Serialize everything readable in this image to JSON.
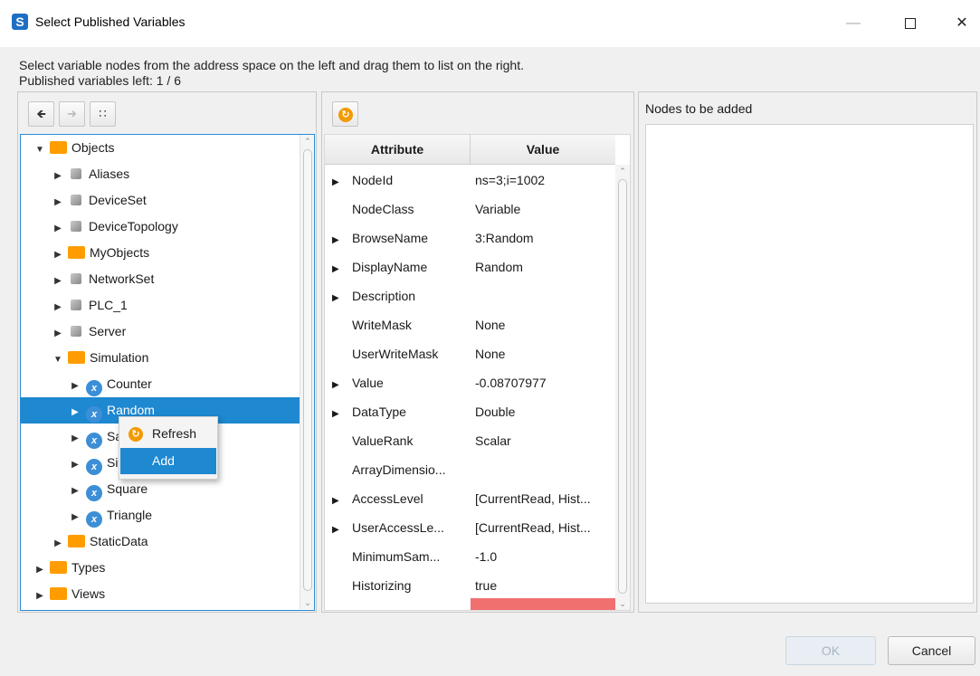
{
  "window": {
    "title": "Select Published Variables",
    "app_icon_letter": "S"
  },
  "instructions": {
    "line1": "Select variable nodes from the address space on the left and drag them to list on the right.",
    "line2": "Published variables left: 1 / 6"
  },
  "left_toolbar": {
    "back_icon": "arrow-left-icon",
    "forward_icon": "arrow-right-icon",
    "collapse_icon": "collapse-icon"
  },
  "tree": [
    {
      "label": "Objects",
      "icon": "folder",
      "level": 0,
      "expanded": true
    },
    {
      "label": "Aliases",
      "icon": "cube",
      "level": 1,
      "expanded": false
    },
    {
      "label": "DeviceSet",
      "icon": "cube",
      "level": 1,
      "expanded": false
    },
    {
      "label": "DeviceTopology",
      "icon": "cube",
      "level": 1,
      "expanded": false
    },
    {
      "label": "MyObjects",
      "icon": "folder",
      "level": 1,
      "expanded": false
    },
    {
      "label": "NetworkSet",
      "icon": "cube",
      "level": 1,
      "expanded": false
    },
    {
      "label": "PLC_1",
      "icon": "cube",
      "level": 1,
      "expanded": false
    },
    {
      "label": "Server",
      "icon": "cube",
      "level": 1,
      "expanded": false
    },
    {
      "label": "Simulation",
      "icon": "folder",
      "level": 1,
      "expanded": true
    },
    {
      "label": "Counter",
      "icon": "variable",
      "level": 2,
      "expanded": false
    },
    {
      "label": "Random",
      "icon": "variable",
      "level": 2,
      "expanded": false,
      "selected": true
    },
    {
      "label": "Sawtooth",
      "icon": "variable",
      "level": 2,
      "expanded": false
    },
    {
      "label": "Sinusoid",
      "icon": "variable",
      "level": 2,
      "expanded": false
    },
    {
      "label": "Square",
      "icon": "variable",
      "level": 2,
      "expanded": false
    },
    {
      "label": "Triangle",
      "icon": "variable",
      "level": 2,
      "expanded": false
    },
    {
      "label": "StaticData",
      "icon": "folder",
      "level": 1,
      "expanded": false
    },
    {
      "label": "Types",
      "icon": "folder",
      "level": 0,
      "expanded": false
    },
    {
      "label": "Views",
      "icon": "folder",
      "level": 0,
      "expanded": false
    }
  ],
  "attributes": {
    "header_attribute": "Attribute",
    "header_value": "Value",
    "rows": [
      {
        "name": "NodeId",
        "value": "ns=3;i=1002",
        "expandable": true
      },
      {
        "name": "NodeClass",
        "value": "Variable",
        "expandable": false
      },
      {
        "name": "BrowseName",
        "value": "3:Random",
        "expandable": true
      },
      {
        "name": "DisplayName",
        "value": "Random",
        "expandable": true
      },
      {
        "name": "Description",
        "value": "",
        "expandable": true
      },
      {
        "name": "WriteMask",
        "value": "None",
        "expandable": false
      },
      {
        "name": "UserWriteMask",
        "value": "None",
        "expandable": false
      },
      {
        "name": "Value",
        "value": "-0.08707977",
        "expandable": true
      },
      {
        "name": "DataType",
        "value": "Double",
        "expandable": true
      },
      {
        "name": "ValueRank",
        "value": "Scalar",
        "expandable": false
      },
      {
        "name": "ArrayDimensio...",
        "value": "",
        "expandable": false
      },
      {
        "name": "AccessLevel",
        "value": "[CurrentRead, Hist...",
        "expandable": true
      },
      {
        "name": "UserAccessLe...",
        "value": "[CurrentRead, Hist...",
        "expandable": true
      },
      {
        "name": "MinimumSam...",
        "value": "-1.0",
        "expandable": false
      },
      {
        "name": "Historizing",
        "value": "true",
        "expandable": false
      }
    ]
  },
  "nodes_panel": {
    "label": "Nodes to be added"
  },
  "context_menu": {
    "refresh_label": "Refresh",
    "add_label": "Add"
  },
  "buttons": {
    "ok": "OK",
    "cancel": "Cancel"
  },
  "colors": {
    "selection": "#1e88d1",
    "folder": "#ff9d00",
    "refresh_icon": "#f39a00",
    "highlight_red": "#f07070"
  }
}
